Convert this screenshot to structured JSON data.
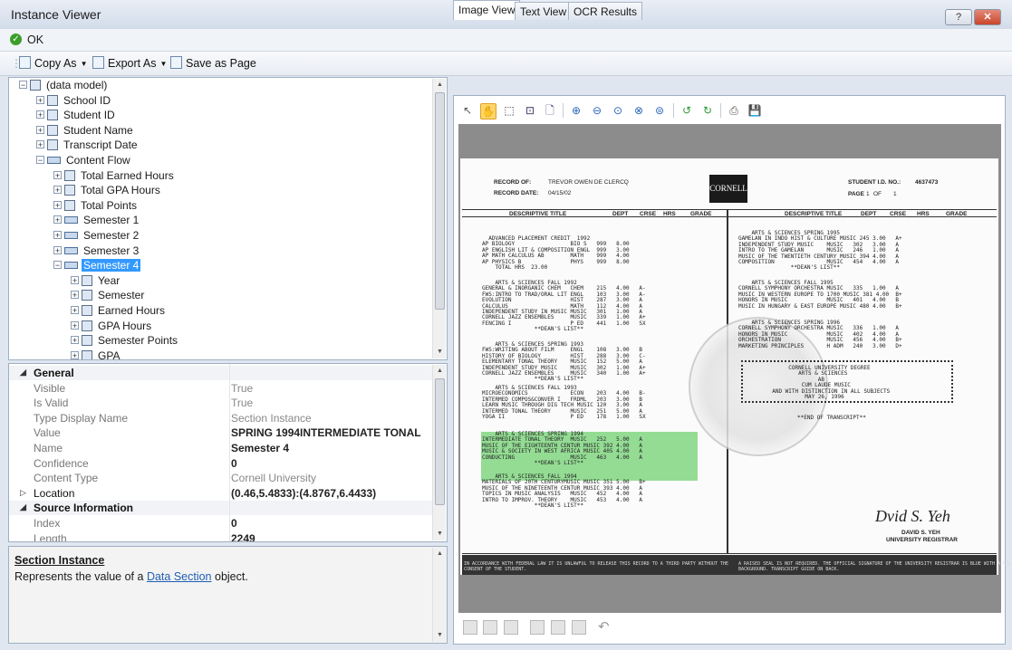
{
  "window": {
    "title": "Instance Viewer",
    "help_button": "?",
    "close_button": "✕"
  },
  "okbar": {
    "ok_label": "OK"
  },
  "toolbar": {
    "copy_as": "Copy As",
    "export_as": "Export As",
    "save_as_page": "Save as Page"
  },
  "tree": {
    "items": [
      {
        "label": "(data model)",
        "level": 0,
        "toggle": "−",
        "selected": false
      },
      {
        "label": "School ID",
        "level": 1,
        "toggle": "+",
        "selected": false
      },
      {
        "label": "Student ID",
        "level": 1,
        "toggle": "+",
        "selected": false
      },
      {
        "label": "Student Name",
        "level": 1,
        "toggle": "+",
        "selected": false
      },
      {
        "label": "Transcript Date",
        "level": 1,
        "toggle": "+",
        "selected": false
      },
      {
        "label": "Content Flow",
        "level": 1,
        "toggle": "−",
        "selected": false
      },
      {
        "label": "Total Earned Hours",
        "level": 2,
        "toggle": "+",
        "selected": false
      },
      {
        "label": "Total GPA Hours",
        "level": 2,
        "toggle": "+",
        "selected": false
      },
      {
        "label": "Total Points",
        "level": 2,
        "toggle": "+",
        "selected": false
      },
      {
        "label": "Semester 1",
        "level": 2,
        "toggle": "+",
        "selected": false
      },
      {
        "label": "Semester 2",
        "level": 2,
        "toggle": "+",
        "selected": false
      },
      {
        "label": "Semester 3",
        "level": 2,
        "toggle": "+",
        "selected": false
      },
      {
        "label": "Semester 4",
        "level": 2,
        "toggle": "−",
        "selected": true
      },
      {
        "label": "Year",
        "level": 3,
        "toggle": "+",
        "selected": false
      },
      {
        "label": "Semester",
        "level": 3,
        "toggle": "+",
        "selected": false
      },
      {
        "label": "Earned Hours",
        "level": 3,
        "toggle": "+",
        "selected": false
      },
      {
        "label": "GPA Hours",
        "level": 3,
        "toggle": "+",
        "selected": false
      },
      {
        "label": "Semester Points",
        "level": 3,
        "toggle": "+",
        "selected": false
      },
      {
        "label": "GPA",
        "level": 3,
        "toggle": "+",
        "selected": false
      }
    ]
  },
  "properties": {
    "rows": [
      {
        "kind": "category",
        "name": "General",
        "value": ""
      },
      {
        "kind": "prop",
        "name": "Visible",
        "value": "True",
        "bold": false
      },
      {
        "kind": "prop",
        "name": "Is Valid",
        "value": "True",
        "bold": false
      },
      {
        "kind": "prop",
        "name": "Type Display Name",
        "value": "Section Instance",
        "bold": false
      },
      {
        "kind": "prop",
        "name": "Value",
        "value": "SPRING 1994INTERMEDIATE TONAL",
        "bold": true
      },
      {
        "kind": "prop",
        "name": "Name",
        "value": "Semester 4",
        "bold": true
      },
      {
        "kind": "prop",
        "name": "Confidence",
        "value": "0",
        "bold": true
      },
      {
        "kind": "prop",
        "name": "Content Type",
        "value": "Cornell University",
        "bold": false
      },
      {
        "kind": "expandable",
        "name": "Location",
        "value": "(0.46,5.4833):(4.8767,6.4433)",
        "bold": true
      },
      {
        "kind": "category",
        "name": "Source Information",
        "value": ""
      },
      {
        "kind": "prop",
        "name": "Index",
        "value": "0",
        "bold": true
      },
      {
        "kind": "prop",
        "name": "Length",
        "value": "2249",
        "bold": true
      }
    ]
  },
  "help": {
    "title": "Section Instance",
    "text_before": "Represents the value of a ",
    "link": "Data Section",
    "text_after": " object."
  },
  "tabs": [
    {
      "label": "Image View",
      "active": true
    },
    {
      "label": "Text View",
      "active": false
    },
    {
      "label": "OCR Results",
      "active": false
    }
  ],
  "transcript": {
    "record_of_label": "RECORD OF:",
    "record_of": "TREVOR OWEN DE CLERCQ",
    "record_date_label": "RECORD DATE:",
    "record_date": "04/15/02",
    "logo": "CORNELL",
    "student_id_label": "STUDENT I.D. NO.:",
    "student_id": "4637473",
    "page_label": "PAGE",
    "page": "1",
    "of_label": "OF",
    "of": "1",
    "col_headers": [
      "DESCRIPTIVE TITLE",
      "DEPT",
      "CRSE",
      "HRS",
      "GRADE"
    ],
    "left_block_1": "  ADVANCED PLACEMENT CREDIT  1992\nAP BIOLOGY                 BIO S   999   8.00\nAP ENGLISH LIT & COMPOSITION ENGL  999   3.00\nAP MATH CALCULUS AB        MATH    999   4.00\nAP PHYSICS B               PHYS    999   8.00\n    TOTAL HRS  23.00",
    "left_block_2": "    ARTS & SCIENCES FALL 1992\nGENERAL & INORGANIC CHEM   CHEM    215   4.00   A-\nFWS:INTRO TO TRAD/ORAL LIT ENGL    103   3.00   A-\nEVOLUTION                  HIST    287   3.00   A\nCALCULUS                   MATH    112   4.00   A\nINDEPENDENT STUDY IN MUSIC MUSIC   301   1.00   A\nCORNELL JAZZ ENSEMBLES     MUSIC   339   1.00   A+\nFENCING I                  P ED    441   1.00   SX\n                **DEAN'S LIST**",
    "left_block_3": "    ARTS & SCIENCES SPRING 1993\nFWS:WRITING ABOUT FILM     ENGL    108   3.00   B\nHISTORY OF BIOLOGY         HIST    288   3.00   C-\nELEMENTARY TONAL THEORY    MUSIC   152   5.00   A\nINDEPENDENT STUDY MUSIC    MUSIC   302   1.00   A+\nCORNELL JAZZ ENSEMBLES     MUSIC   340   1.00   A+\n                **DEAN'S LIST**",
    "left_block_4": "    ARTS & SCIENCES FALL 1993\nMICROECONOMICS             ECON    203   4.00   B-\nINTERMED COMPOS&CONVER I   FRDML   203   3.00   B\nLEARN MUSIC THROUGH DIG TECH MUSIC 120   3.00   A\nINTERMED TONAL THEORY      MUSIC   251   5.00   A\nYOGA II                    P ED    178   1.00   SX",
    "left_block_5": "    ARTS & SCIENCES SPRING 1994\nINTERMEDIATE TONAL THEORY  MUSIC   252   5.00   A\nMUSIC OF THE EIGHTEENTH CENTUR MUSIC 392 4.00   A\nMUSIC & SOCIETY IN WEST AFRICA MUSIC 405 4.00   A\nCONDUCTING                 MUSIC   463   4.00   A\n                **DEAN'S LIST**",
    "left_block_6": "    ARTS & SCIENCES FALL 1994\nMATERIALS OF 20TH CENTURYMUSIC MUSIC 351 5.00   B+\nMUSIC OF THE NINETEENTH CENTUR MUSIC 393 4.00   A\nTOPICS IN MUSIC ANALYSIS   MUSIC   452   4.00   A\nINTRO TO IMPROV. THEORY    MUSIC   453   4.00   A\n                **DEAN'S LIST**",
    "right_block_1": "    ARTS & SCIENCES SPRING 1995\nGAMELAN IN INDO HIST & CULTURE MUSIC 245 3.00   A+\nINDEPENDENT STUDY MUSIC    MUSIC   302   3.00   A\nINTRO TO THE GAMELAN       MUSIC   246   1.00   A\nMUSIC OF THE TWENTIETH CENTURY MUSIC 394 4.00   A\nCOMPOSITION                MUSIC   454   4.00   A\n                **DEAN'S LIST**",
    "right_block_2": "    ARTS & SCIENCES FALL 1995\nCORNELL SYMPHONY ORCHESTRA MUSIC   335   1.00   A\nMUSIC IN WESTERN EUROPE TO 1700 MUSIC 381 4.00  B+\nHONORS IN MUSIC            MUSIC   401   4.00   B\nMUSIC IN HUNGARY & EAST EUROPE MUSIC 480 4.00   B+",
    "right_block_3": "    ARTS & SCIENCES SPRING 1996\nCORNELL SYMPHONY ORCHESTRA MUSIC   336   1.00   A\nHONORS IN MUSIC            MUSIC   402   4.00   A\nORCHESTRATION              MUSIC   456   4.00   B+\nMARKETING PRINCIPLES       H ADM   240   3.00   D+",
    "degree_block": "       CORNELL UNIVERSITY DEGREE\n          ARTS & SCIENCES\n                AB\n           CUM LAUDE MUSIC\n  AND WITH DISTINCTION IN ALL SUBJECTS\n            MAY 26, 1996",
    "end_note": "**END OF TRANSCRIPT**",
    "signer_name": "DAVID S. YEH",
    "signer_title": "UNIVERSITY REGISTRAR",
    "footer_left": "IN ACCORDANCE WITH FEDERAL LAW IT IS UNLAWFUL TO RELEASE THIS RECORD TO A THIRD PARTY WITHOUT THE\nCONSENT OF THE STUDENT.",
    "footer_right": "A RAISED SEAL IS NOT REQUIRED. THE OFFICIAL SIGNATURE OF THE UNIVERSITY REGISTRAR IS BLUE WITH A RED\nBACKGROUND. TRANSCRIPT GUIDE ON BACK."
  }
}
